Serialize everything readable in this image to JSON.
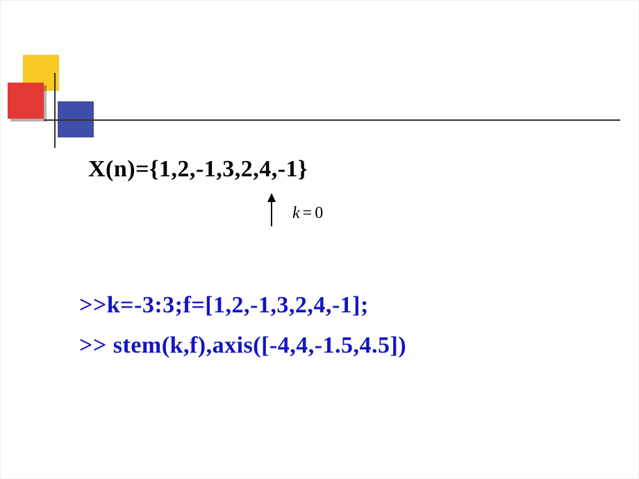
{
  "sequence": {
    "definition": "X(n)={1,2,-1,3,2,4,-1}",
    "index_label": "k",
    "index_equals": "=",
    "index_value": "0"
  },
  "code": {
    "line1": ">>k=-3:3;f=[1,2,-1,3,2,4,-1];",
    "line2": ">> stem(k,f),axis([-4,4,-1.5,4.5])"
  }
}
